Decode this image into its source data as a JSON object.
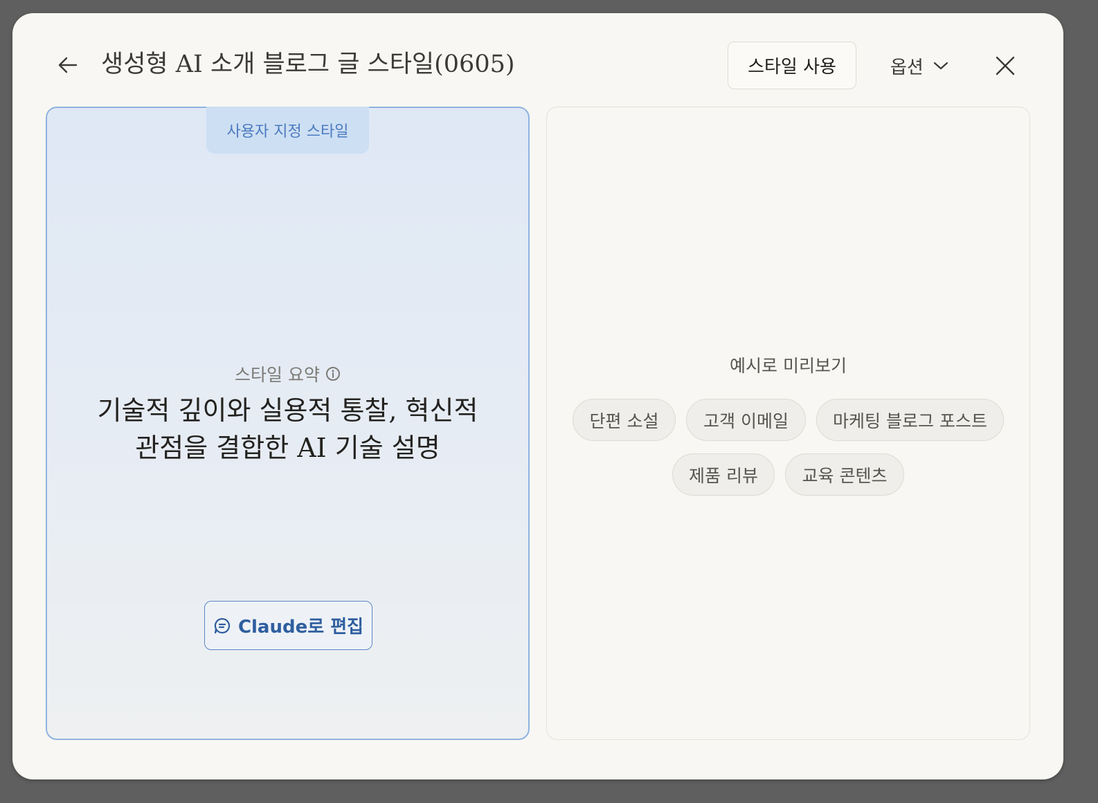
{
  "header": {
    "title": "생성형 AI 소개 블로그 글 스타일(0605)",
    "use_style_label": "스타일 사용",
    "options_label": "옵션",
    "back_icon": "arrow-left-icon",
    "close_icon": "close-icon"
  },
  "left_panel": {
    "tab_label": "사용자 지정 스타일",
    "summary_label": "스타일 요약",
    "summary_text_line1": "기술적 깊이와 실용적 통찰, 혁신적",
    "summary_text_line2": "관점을 결합한 AI 기술 설명",
    "edit_button_label": "Claude로 편집"
  },
  "right_panel": {
    "preview_label": "예시로 미리보기",
    "chips": [
      {
        "label": "단편 소설"
      },
      {
        "label": "고객 이메일"
      },
      {
        "label": "마케팅 블로그 포스트"
      },
      {
        "label": "제품 리뷰"
      },
      {
        "label": "교육 콘텐츠"
      }
    ]
  },
  "colors": {
    "accent": "#2f5e9f",
    "panel_border": "#8fb3e0",
    "tab_bg": "#cddff3",
    "modal_bg": "#f8f7f3"
  }
}
